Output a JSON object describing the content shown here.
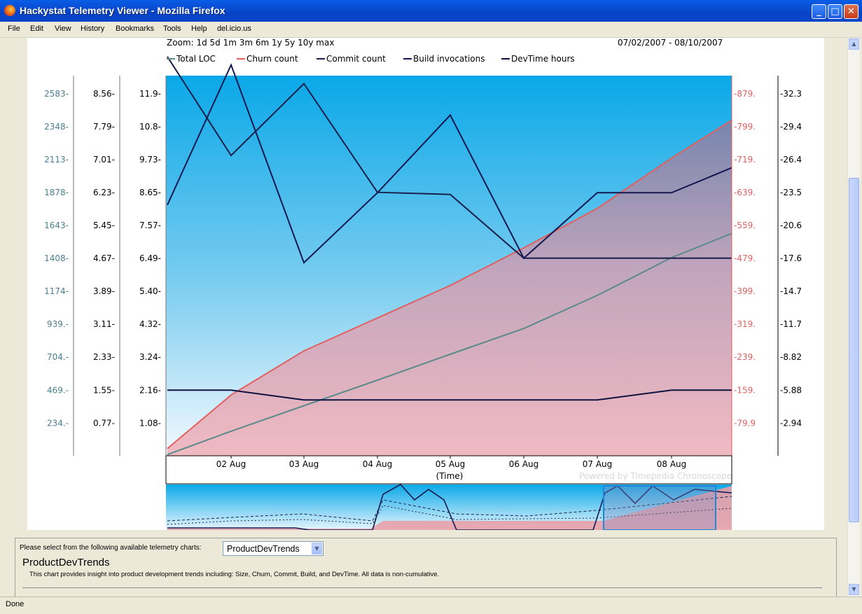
{
  "window": {
    "title": "Hackystat Telemetry Viewer - Mozilla Firefox"
  },
  "menu": [
    "File",
    "Edit",
    "View",
    "History",
    "Bookmarks",
    "Tools",
    "Help",
    "del.icio.us"
  ],
  "status": "Done",
  "chart_header": {
    "zoom": "Zoom: 1d 5d 1m 3m 6m 1y 5y 10y max",
    "date_range": "07/02/2007 - 08/10/2007"
  },
  "colors": {
    "total_loc": "#5a8a8a",
    "churn": "#e06060",
    "commit": "#1a1f4a",
    "build": "#141850",
    "devtime": "#0e1240",
    "sky": "#0aa8e8",
    "churn_fill": "#e8a0a8"
  },
  "chart_data": {
    "type": "line",
    "xlabel": "(Time)",
    "x_ticks": [
      "02 Aug",
      "03 Aug",
      "04 Aug",
      "05 Aug",
      "06 Aug",
      "07 Aug",
      "08 Aug"
    ],
    "watermark": "Powered by Timepedia Chronoscope",
    "x": [
      "2007-08-01",
      "2007-08-02",
      "2007-08-03",
      "2007-08-04",
      "2007-08-05",
      "2007-08-06",
      "2007-08-07",
      "2007-08-08",
      "2007-08-09"
    ],
    "axes": [
      {
        "id": "loc",
        "color": "#4a7f90",
        "ticks": [
          "2583",
          "2348",
          "2113",
          "1878",
          "1643",
          "1408",
          "1174",
          "939.",
          "704.",
          "469.",
          "234."
        ]
      },
      {
        "id": "commit",
        "color": "#000000",
        "ticks": [
          "8.56",
          "7.79",
          "7.01",
          "6.23",
          "5.45",
          "4.67",
          "3.89",
          "3.11",
          "2.33",
          "1.55",
          "0.77"
        ]
      },
      {
        "id": "build",
        "color": "#000000",
        "ticks": [
          "11.9",
          "10.8",
          "9.73",
          "8.65",
          "7.57",
          "6.49",
          "5.40",
          "4.32",
          "3.24",
          "2.16",
          "1.08"
        ]
      },
      {
        "id": "churn",
        "color": "#e06060",
        "ticks": [
          "879.",
          "799.",
          "719.",
          "639.",
          "559.",
          "479.",
          "399.",
          "319.",
          "239.",
          "159.",
          "79.9"
        ]
      },
      {
        "id": "devtime",
        "color": "#000000",
        "ticks": [
          "32.3",
          "29.4",
          "26.4",
          "23.5",
          "20.6",
          "17.6",
          "14.7",
          "11.7",
          "8.82",
          "5.88",
          "2.94"
        ]
      }
    ],
    "series": [
      {
        "name": "Total LOC",
        "axis": "loc",
        "color": "#5a8a8a",
        "values": [
          9,
          176,
          358,
          540,
          725,
          909,
          1145,
          1414,
          1587
        ]
      },
      {
        "name": "Churn count",
        "axis": "churn",
        "color": "#e06060",
        "values": [
          18,
          148,
          255,
          335,
          414,
          505,
          601,
          723,
          815
        ]
      },
      {
        "name": "Commit count",
        "axis": "commit",
        "color": "#1a1f4a",
        "values": [
          9.44,
          7.1,
          8.8,
          6.23,
          6.18,
          4.67,
          4.67,
          4.67,
          4.67
        ]
      },
      {
        "name": "Build invocations",
        "axis": "build",
        "color": "#141850",
        "values": [
          8.25,
          12.85,
          6.35,
          8.65,
          11.2,
          6.5,
          8.65,
          8.65,
          9.47
        ]
      },
      {
        "name": "DevTime hours",
        "axis": "devtime",
        "color": "#0e1240",
        "values": [
          5.88,
          5.88,
          5.0,
          5.0,
          5.0,
          5.0,
          5.0,
          5.88,
          5.88
        ]
      }
    ]
  },
  "bottom": {
    "prompt": "Please select from the following available telemetry charts:",
    "selected": "ProductDevTrends",
    "title": "ProductDevTrends",
    "description": "This chart provides insight into product development trends including: Size, Churn, Commit, Build, and DevTime. All data is non-cumulative."
  }
}
